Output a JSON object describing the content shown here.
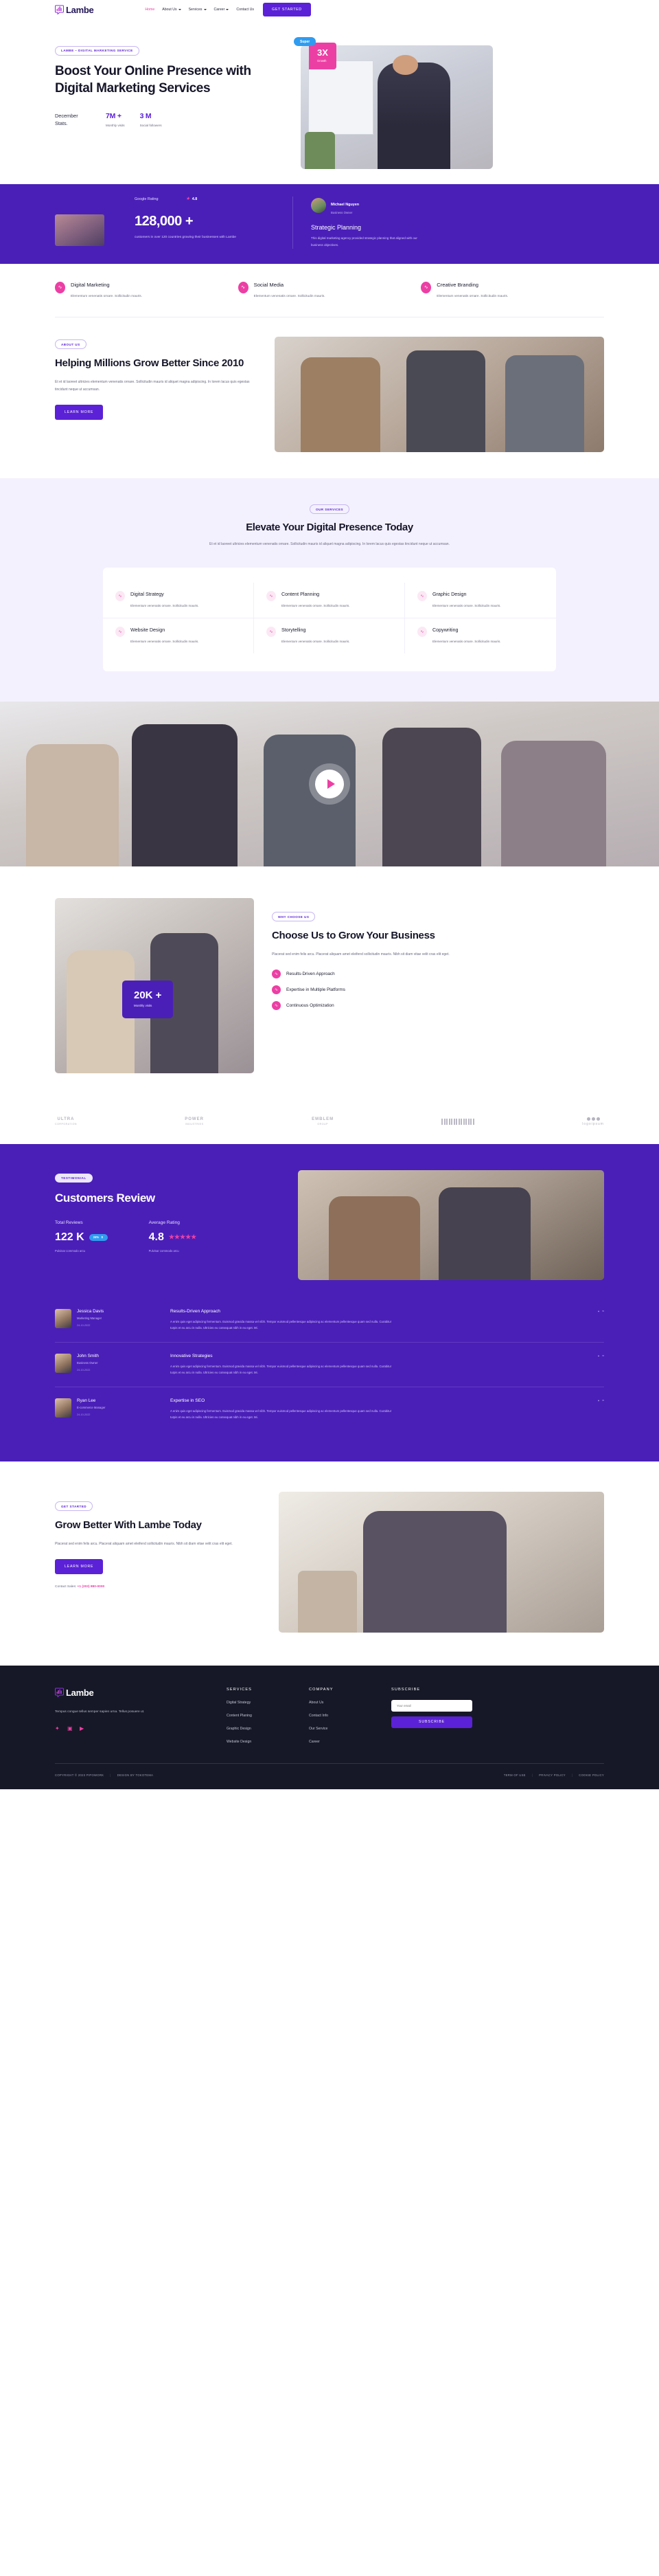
{
  "header": {
    "brand": "Lambe",
    "nav": [
      {
        "label": "Home",
        "active": true,
        "caret": false
      },
      {
        "label": "About Us",
        "active": false,
        "caret": true
      },
      {
        "label": "Services",
        "active": false,
        "caret": true
      },
      {
        "label": "Career",
        "active": false,
        "caret": true
      },
      {
        "label": "Contact Us",
        "active": false,
        "caret": false
      }
    ],
    "cta": "GET STARTED"
  },
  "hero": {
    "pill": "LAMBE – DIGITAL MARKETING SERVICE",
    "heading": "Boost Your Online Presence with Digital Marketing Services",
    "stats_label": "December Stats.",
    "stats": [
      {
        "value": "7M +",
        "caption": "Monthly visits"
      },
      {
        "value": "3 M",
        "caption": "Social followers"
      }
    ],
    "badge_super": "Super",
    "badge_multiplier": "3X",
    "badge_multiplier_sub": "Growth"
  },
  "band": {
    "google_rating_label": "Google Rating",
    "google_rating_value": "4.8",
    "big_number": "128,000 +",
    "big_caption": "customers in over 120 countries growing their businesses with Lambe",
    "person_name": "Michael Nguyen",
    "person_role": "Business Owner",
    "quote_title": "Strategic Planning",
    "quote_text": "This digital marketing agency provided strategic planning that aligned with our business objectives."
  },
  "features": [
    {
      "title": "Digital Marketing",
      "desc": "Elementum venenatis ornare. Sollicitudin mauris."
    },
    {
      "title": "Social Media",
      "desc": "Elementum venenatis ornare. Sollicitudin mauris."
    },
    {
      "title": "Creative Branding",
      "desc": "Elementum venenatis ornare. Sollicitudin mauris."
    }
  ],
  "about": {
    "pill": "ABOUT US",
    "heading": "Helping Millions Grow Better Since 2010",
    "desc": "Et et id laoreet ultricies elementum venenatis ornare. Sollicitudin mauris id aliquet magna adipiscing. In lorem lacus quis egestas tincidunt neque ut accumsan.",
    "button": "LEARN MORE"
  },
  "services": {
    "pill": "OUR SERVICES",
    "heading": "Elevate Your Digital Presence Today",
    "desc": "Et et id laoreet ultricies elementum venenatis ornare. Sollicitudin mauris id aliquet magna adipiscing. In lorem lacus quis egestas tincidunt neque ut accumsan.",
    "items": [
      {
        "title": "Digital Strategy",
        "desc": "Elementum venenatis ornare. Sollicitudin mauris."
      },
      {
        "title": "Content Planning",
        "desc": "Elementum venenatis ornare. Sollicitudin mauris."
      },
      {
        "title": "Graphic Design",
        "desc": "Elementum venenatis ornare. Sollicitudin mauris."
      },
      {
        "title": "Website Design",
        "desc": "Elementum venenatis ornare. Sollicitudin mauris."
      },
      {
        "title": "Storytelling",
        "desc": "Elementum venenatis ornare. Sollicitudin mauris."
      },
      {
        "title": "Copywriting",
        "desc": "Elementum venenatis ornare. Sollicitudin mauris."
      }
    ]
  },
  "why": {
    "pill": "WHY CHOOSE US",
    "heading": "Choose Us to Grow Your Business",
    "desc": "Placerat sed enim felis arcu. Placerat aliquam amet eleifend sollicitudin mauris. Nibh sit diam vitae velit cras elit eget.",
    "badge_value": "20K +",
    "badge_caption": "Monthly visits",
    "list": [
      "Results-Driven Approach",
      "Expertise in Multiple Platforms",
      "Continuous Optimization"
    ]
  },
  "logos": [
    {
      "top": "ULTRA",
      "bottom": "CORPORATION"
    },
    {
      "top": "POWER",
      "bottom": "INDUSTRIES"
    },
    {
      "top": "EMBLEM",
      "bottom": "GROUP"
    },
    {
      "top": "BARCODE",
      "bottom": "SYSTEMS"
    },
    {
      "top": "logoipsum",
      "bottom": ""
    }
  ],
  "testimonial": {
    "pill": "TESTIMONIAL",
    "heading": "Customers Review",
    "total_label": "Total Reviews",
    "total_value": "122 K",
    "total_chip": "24%",
    "total_note": "Pulvinar commodo arcu",
    "avg_label": "Average Rating",
    "avg_value": "4.8",
    "avg_stars": "★★★★★",
    "avg_note": "Pulvinar commodo arcu",
    "reviews": [
      {
        "name": "Jessica Davis",
        "role": "Marketing Manager",
        "date": "24-10-2022",
        "title": "Results-Driven Approach",
        "text": "A enim quis eget adipiscing fermentum. Euismod gravida massa vel nibh. Tempor euismod pellentesque adipiscing ac elementum pellentesque quam sed nulla. Curabitur turpis et eu arcu in nulla. Ultricies eu consequat nibh in eu eget. Mi."
      },
      {
        "name": "John Smith",
        "role": "Business Owner",
        "date": "24-10-2022",
        "title": "Innovative Strategies",
        "text": "A enim quis eget adipiscing fermentum. Euismod gravida massa vel nibh. Tempor euismod pellentesque adipiscing ac elementum pellentesque quam sed nulla. Curabitur turpis et eu arcu in nulla. Ultricies eu consequat nibh in eu eget. Mi."
      },
      {
        "name": "Ryan Lee",
        "role": "E-commerce Manager",
        "date": "24-10-2022",
        "title": "Expertise in SEO",
        "text": "A enim quis eget adipiscing fermentum. Euismod gravida massa vel nibh. Tempor euismod pellentesque adipiscing ac elementum pellentesque quam sed nulla. Curabitur turpis et eu arcu in nulla. Ultricies eu consequat nibh in eu eget. Mi."
      }
    ]
  },
  "grow": {
    "pill": "GET STARTED",
    "heading": "Grow Better With Lambe Today",
    "desc": "Placerat sed enim felis arcu. Placerat aliquam amet eleifend sollicitudin mauris. Nibh sit diam vitae velit cras elit eget.",
    "button": "LEARN MORE",
    "contact_label": "Contact Sales:",
    "contact_phone": "+1 (203) 880-0000"
  },
  "footer": {
    "brand": "Lambe",
    "desc": "Tempus congue tellus semper sapien urna. Tellus posuere ut.",
    "social": [
      "twitter-icon",
      "instagram-icon",
      "youtube-icon"
    ],
    "services_title": "SERVICES",
    "services": [
      "Digital Strategy",
      "Content Planing",
      "Graphic Design",
      "Website Design"
    ],
    "company_title": "COMPANY",
    "company": [
      "About Us",
      "Contact Info",
      "Our Service",
      "Career"
    ],
    "subscribe_title": "SUBSCRIBE",
    "email_placeholder": "Your email",
    "subscribe_button": "SUBSCRIBE",
    "copyright": "COPYRIGHT © 2023 PIPOWORK",
    "design_by": "DESIGN BY TOKOTEMA",
    "legal": [
      "TERM OF USE",
      "PRIVACY POLICY",
      "COOKIE POLICY"
    ]
  },
  "colors": {
    "purple": "#4a1fb8",
    "violet": "#5b21d6",
    "pink": "#ec3fa4",
    "dark": "#161827",
    "lilac_bg": "#f4f1fe"
  }
}
